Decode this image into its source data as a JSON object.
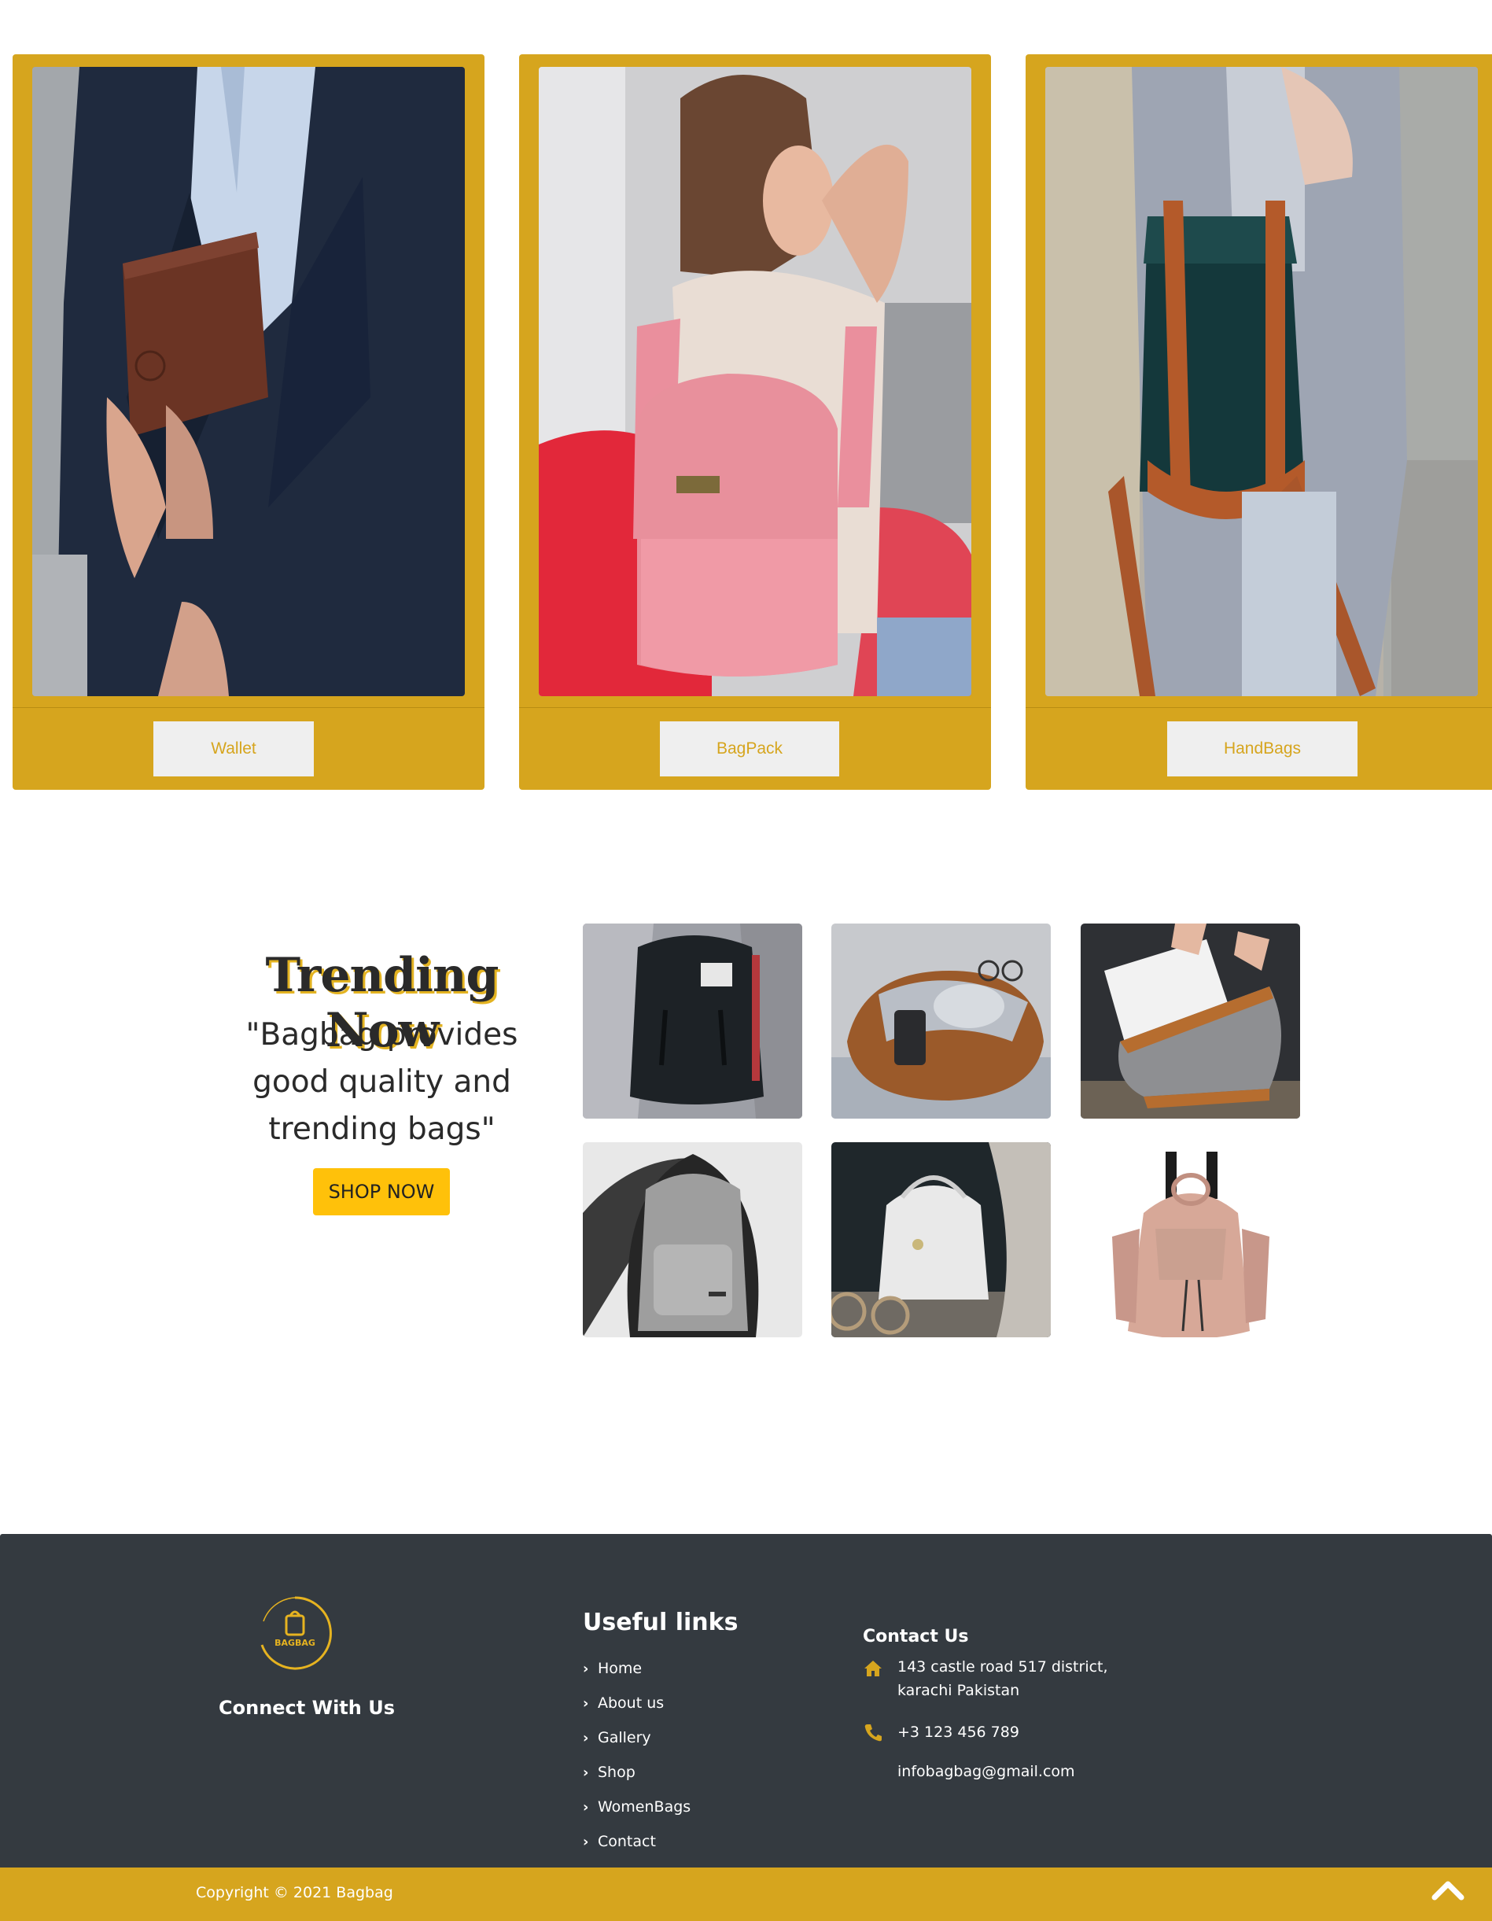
{
  "categories": [
    {
      "label": "Wallet"
    },
    {
      "label": "BagPack"
    },
    {
      "label": "HandBags"
    }
  ],
  "trending": {
    "title": "Trending Now",
    "quote": "\"Bagbag provides good quality and trending bags\"",
    "button": "SHOP NOW"
  },
  "footer": {
    "logo_text": "BAGBAG",
    "connect": "Connect With Us",
    "links_title": "Useful links",
    "links": [
      "Home",
      "About us",
      "Gallery",
      "Shop",
      "WomenBags",
      "Contact"
    ],
    "contact_title": "Contact Us",
    "address_line1": "143 castle road 517 district,",
    "address_line2": "karachi Pakistan",
    "phone": "+3 123 456 789",
    "email": "infobagbag@gmail.com",
    "copyright": "Copyright © 2021 Bagbag"
  },
  "colors": {
    "accent": "#d6a51e",
    "shop_button": "#ffc10a",
    "footer_bg": "#343a40"
  }
}
